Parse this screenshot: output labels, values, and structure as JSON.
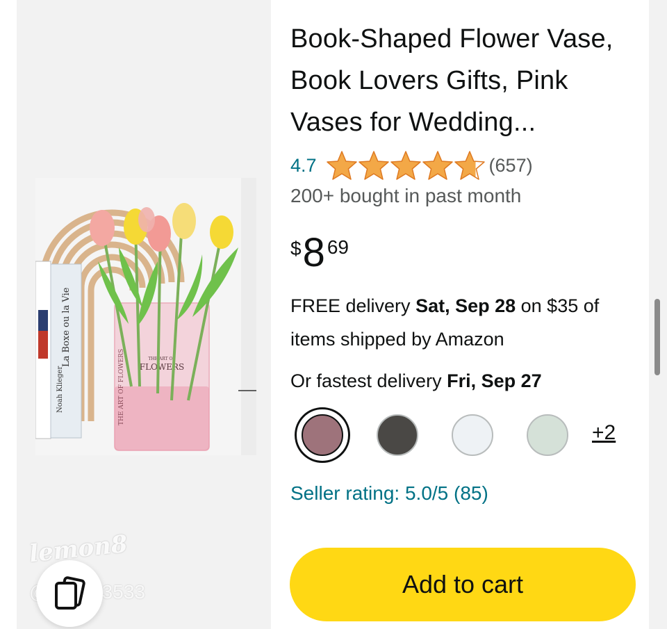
{
  "product": {
    "title": "Book-Shaped Flower Vase, Book Lovers Gifts, Pink Vases for Wedding...",
    "rating_value": "4.7",
    "rating_stars": 4.7,
    "review_count": "(657)",
    "bought": "200+ bought in past month",
    "price": {
      "symbol": "$",
      "whole": "8",
      "fraction": "69"
    },
    "image_alt": "Pink acrylic book-shaped vase holding tulips beside books",
    "vase_text": {
      "small": "THE ART OF",
      "big": "FLOWERS",
      "spine": "THE ART OF FLOWERS"
    },
    "book_spines": [
      "La Boxe ou la Vie",
      "Noah Klieger"
    ]
  },
  "delivery": {
    "prefix": "FREE delivery ",
    "date": "Sat, Sep 28",
    "suffix": " on $35 of items shipped by Amazon",
    "fastest_prefix": "Or fastest delivery ",
    "fastest_date": "Fri, Sep 27"
  },
  "colors": {
    "swatches": [
      "#9e737b",
      "#4a4845",
      "#eef2f5",
      "#d5e1d8"
    ],
    "selected_index": 0,
    "more_label": "+2"
  },
  "seller": {
    "rating_text": "Seller rating: 5.0/5 (85)"
  },
  "actions": {
    "add_to_cart": "Add to cart"
  },
  "watermark": {
    "logo": "lemon8",
    "handle": "@neelm3533"
  },
  "theme": {
    "star_color": "#f3a847",
    "link_color": "#007185",
    "button_color": "#ffd814",
    "text_color": "#0f1111",
    "secondary_text": "#565959"
  }
}
